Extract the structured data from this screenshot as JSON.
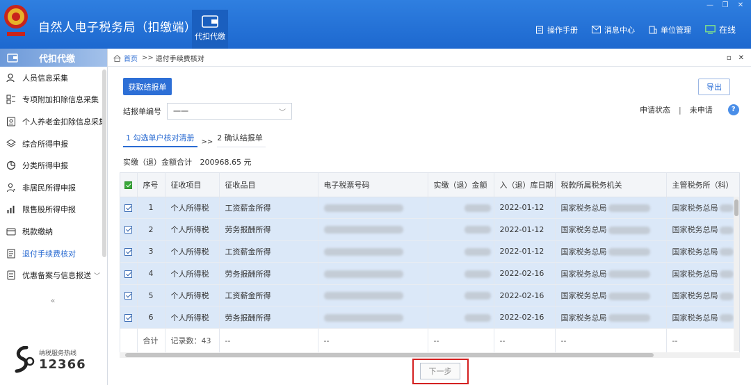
{
  "app": {
    "title": "自然人电子税务局（扣缴端）",
    "module_tab": "代扣代缴",
    "links": [
      {
        "label": "操作手册",
        "icon": "manual-icon"
      },
      {
        "label": "消息中心",
        "icon": "mail-icon"
      },
      {
        "label": "单位管理",
        "icon": "building-icon"
      }
    ],
    "online_label": "在线"
  },
  "sidebar": {
    "title": "代扣代缴",
    "items": [
      {
        "label": "人员信息采集",
        "icon": "person-icon"
      },
      {
        "label": "专项附加扣除信息采集",
        "icon": "grid-icon"
      },
      {
        "label": "个人养老金扣除信息采集",
        "icon": "id-card-icon"
      },
      {
        "label": "综合所得申报",
        "icon": "layers-icon"
      },
      {
        "label": "分类所得申报",
        "icon": "pie-icon"
      },
      {
        "label": "非居民所得申报",
        "icon": "person-outline-icon"
      },
      {
        "label": "限售股所得申报",
        "icon": "bar-chart-icon"
      },
      {
        "label": "税款缴纳",
        "icon": "wallet-icon"
      },
      {
        "label": "退付手续费核对",
        "icon": "document-icon",
        "active": true
      },
      {
        "label": "优惠备案与信息报送",
        "icon": "form-icon"
      }
    ],
    "collapse": "«",
    "hotline_caption": "纳税服务热线",
    "hotline_number": "12366"
  },
  "breadcrumb": {
    "home": "首页",
    "sep": ">>",
    "current": "退付手续费核对"
  },
  "toolbar": {
    "fetch_label": "获取结报单",
    "export_label": "导出"
  },
  "form": {
    "statement_label": "结报单编号",
    "statement_value": "一一"
  },
  "status": {
    "label": "申请状态",
    "divider": "|",
    "value": "未申请",
    "help": "?"
  },
  "steps": {
    "step1": "1 勾选单户核对清册",
    "arrows": ">>",
    "step2": "2 确认结报单"
  },
  "totals": {
    "label": "实缴（退）金额合计",
    "value": "200968.65 元"
  },
  "table": {
    "columns": [
      "序号",
      "征收项目",
      "征收品目",
      "电子税票号码",
      "实缴（退）金额",
      "入（退）库日期",
      "税款所属税务机关",
      "主管税务所（科）"
    ],
    "rows": [
      {
        "no": "1",
        "project": "个人所得税",
        "item": "工资薪金所得",
        "date": "2022-01-12",
        "office": "国家税务总局",
        "bureau": "国家税务总局"
      },
      {
        "no": "2",
        "project": "个人所得税",
        "item": "劳务报酬所得",
        "date": "2022-01-12",
        "office": "国家税务总局",
        "bureau": "国家税务总局"
      },
      {
        "no": "3",
        "project": "个人所得税",
        "item": "工资薪金所得",
        "date": "2022-01-12",
        "office": "国家税务总局",
        "bureau": "国家税务总局"
      },
      {
        "no": "4",
        "project": "个人所得税",
        "item": "劳务报酬所得",
        "date": "2022-02-16",
        "office": "国家税务总局",
        "bureau": "国家税务总局"
      },
      {
        "no": "5",
        "project": "个人所得税",
        "item": "工资薪金所得",
        "date": "2022-02-16",
        "office": "国家税务总局",
        "bureau": "国家税务总局"
      },
      {
        "no": "6",
        "project": "个人所得税",
        "item": "劳务报酬所得",
        "date": "2022-02-16",
        "office": "国家税务总局",
        "bureau": "国家税务总局"
      }
    ],
    "footer": {
      "label": "合计",
      "record_count": "记录数：43",
      "dash": "--"
    }
  },
  "next_label": "下一步"
}
